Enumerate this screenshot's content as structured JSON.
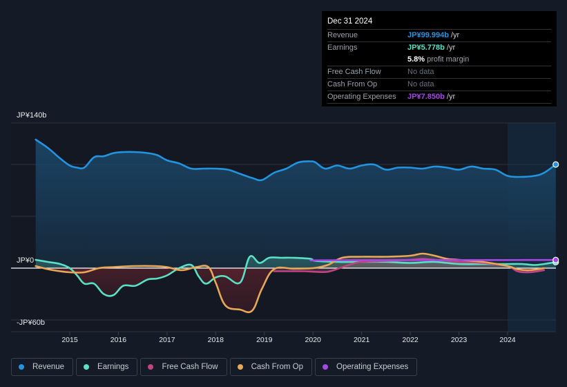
{
  "tooltip": {
    "date": "Dec 31 2024",
    "rows": [
      {
        "label": "Revenue",
        "value": "JP¥99.994b",
        "unit": " /yr",
        "color": "#2394df"
      },
      {
        "label": "Earnings",
        "value": "JP¥5.778b",
        "unit": " /yr",
        "color": "#59e0c5"
      },
      {
        "label": "",
        "value": "5.8%",
        "unit": " profit margin"
      },
      {
        "label": "Free Cash Flow",
        "value": "No data"
      },
      {
        "label": "Cash From Op",
        "value": "No data"
      },
      {
        "label": "Operating Expenses",
        "value": "JP¥7.850b",
        "unit": " /yr",
        "color": "#a548e6"
      }
    ]
  },
  "legend": [
    {
      "label": "Revenue",
      "color": "#2394df"
    },
    {
      "label": "Earnings",
      "color": "#59e0c5"
    },
    {
      "label": "Free Cash Flow",
      "color": "#c2437f"
    },
    {
      "label": "Cash From Op",
      "color": "#e8a857"
    },
    {
      "label": "Operating Expenses",
      "color": "#a548e6"
    }
  ],
  "chart_data": {
    "type": "area",
    "title": "",
    "xlabel": "",
    "ylabel": "",
    "xlim": [
      2014.3,
      2025.0
    ],
    "ylim": [
      -60,
      140
    ],
    "y_tick_labels": [
      "JP¥140b",
      "JP¥0",
      "-JP¥60b"
    ],
    "y_ticks": [
      140,
      0,
      -60
    ],
    "y_gridlines": [
      140,
      100,
      50,
      0,
      -50
    ],
    "x_ticks": [
      2015,
      2016,
      2017,
      2018,
      2019,
      2020,
      2021,
      2022,
      2023,
      2024
    ],
    "x_tick_labels": [
      "2015",
      "2016",
      "2017",
      "2018",
      "2019",
      "2020",
      "2021",
      "2022",
      "2023",
      "2024"
    ],
    "forecast_shade_start": 2024.0,
    "grid": true,
    "legend_position": "bottom-left",
    "series": [
      {
        "name": "Revenue",
        "color": "#2394df",
        "x": [
          2014.3,
          2014.55,
          2014.8,
          2015.0,
          2015.15,
          2015.3,
          2015.5,
          2015.7,
          2015.9,
          2016.1,
          2016.35,
          2016.6,
          2016.8,
          2017.0,
          2017.25,
          2017.5,
          2017.75,
          2018.0,
          2018.25,
          2018.5,
          2018.75,
          2018.95,
          2019.2,
          2019.45,
          2019.7,
          2019.95,
          2020.05,
          2020.25,
          2020.5,
          2020.75,
          2021.0,
          2021.25,
          2021.5,
          2021.75,
          2022.0,
          2022.25,
          2022.5,
          2022.75,
          2023.0,
          2023.25,
          2023.5,
          2023.75,
          2024.0,
          2024.25,
          2024.55,
          2024.75,
          2024.99
        ],
        "values": [
          124,
          116,
          106,
          99,
          97,
          97,
          107,
          108,
          111,
          112,
          112,
          111,
          109,
          104,
          101,
          96,
          96,
          96,
          95,
          91,
          87,
          85,
          92,
          96,
          102,
          103,
          102,
          96,
          99,
          96,
          99,
          100,
          95,
          97,
          97,
          96,
          98,
          97,
          95,
          98,
          96,
          95,
          89,
          88,
          89,
          92,
          100
        ]
      },
      {
        "name": "Earnings",
        "color": "#59e0c5",
        "x": [
          2014.3,
          2014.55,
          2014.8,
          2015.0,
          2015.15,
          2015.3,
          2015.5,
          2015.7,
          2015.9,
          2016.1,
          2016.35,
          2016.6,
          2016.8,
          2017.0,
          2017.25,
          2017.5,
          2017.65,
          2017.8,
          2018.0,
          2018.2,
          2018.5,
          2018.7,
          2018.9,
          2019.1,
          2019.35,
          2019.6,
          2019.95,
          2020.05,
          2020.5,
          2021.0,
          2021.5,
          2022.0,
          2022.5,
          2023.0,
          2023.5,
          2024.0,
          2024.3,
          2024.55,
          2024.75,
          2024.99
        ],
        "values": [
          8,
          6,
          4,
          0,
          -7,
          -15,
          -15,
          -25,
          -26,
          -17,
          -17,
          -11,
          -10,
          -7,
          0,
          3,
          -8,
          -15,
          -9,
          -8,
          -14,
          11,
          5,
          10,
          10,
          10,
          9,
          7,
          6,
          6,
          6,
          5,
          6,
          4,
          4,
          4,
          4,
          3,
          4,
          5.778
        ]
      },
      {
        "name": "Free Cash Flow",
        "color": "#c2437f",
        "x": [
          2019.2,
          2019.5,
          2019.8,
          2020.05,
          2020.3,
          2020.55,
          2020.8,
          2021.0,
          2021.5,
          2022.0,
          2022.25,
          2022.5,
          2022.75,
          2023.0,
          2023.5,
          2024.0,
          2024.2,
          2024.45,
          2024.75
        ],
        "values": [
          -3,
          -3,
          -3,
          -3.5,
          -3.5,
          0,
          4,
          6,
          7,
          8,
          9,
          8,
          7,
          6,
          5,
          2,
          -3,
          -4,
          -2
        ]
      },
      {
        "name": "Cash From Op",
        "color": "#e8a857",
        "x": [
          2014.3,
          2014.55,
          2014.8,
          2015.0,
          2015.3,
          2015.6,
          2015.9,
          2016.3,
          2016.75,
          2017.0,
          2017.3,
          2017.6,
          2017.85,
          2018.0,
          2018.2,
          2018.5,
          2018.75,
          2018.95,
          2019.2,
          2019.6,
          2020.0,
          2020.3,
          2020.6,
          2021.0,
          2021.5,
          2022.0,
          2022.25,
          2022.5,
          2022.75,
          2023.0,
          2023.5,
          2024.0,
          2024.2,
          2024.45,
          2024.75
        ],
        "values": [
          2,
          -1,
          -3,
          -4,
          -4,
          0,
          1,
          2,
          2,
          1,
          -2,
          1,
          1,
          -14,
          -36,
          -40,
          -41,
          -20,
          -1,
          -0.5,
          0,
          3,
          10,
          11,
          11,
          12,
          14,
          12,
          9,
          8,
          6,
          2,
          -1,
          -2,
          0
        ]
      },
      {
        "name": "Operating Expenses",
        "color": "#a548e6",
        "x": [
          2019.95,
          2020.5,
          2021.0,
          2021.5,
          2022.0,
          2022.5,
          2023.0,
          2023.5,
          2024.0,
          2024.5,
          2024.99
        ],
        "values": [
          7.5,
          7.6,
          7.7,
          7.7,
          7.8,
          7.8,
          7.8,
          7.8,
          7.8,
          7.85,
          7.85
        ]
      }
    ]
  }
}
